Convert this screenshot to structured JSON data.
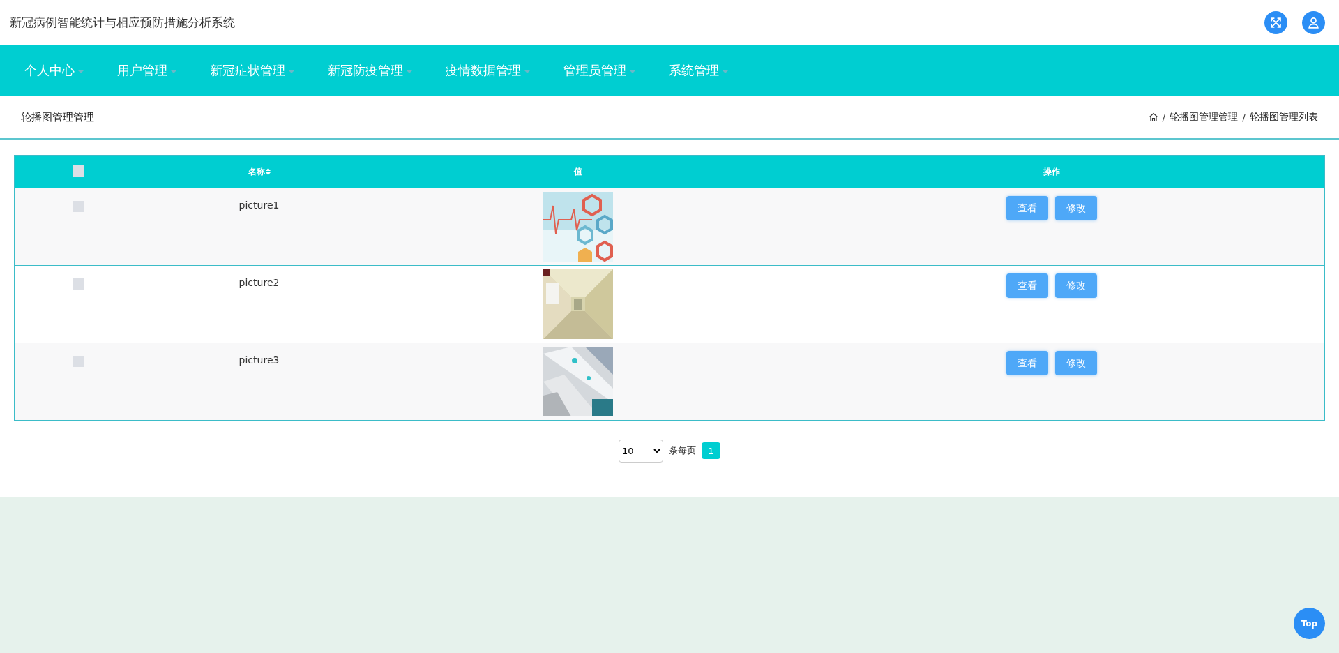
{
  "header": {
    "title": "新冠病例智能统计与相应预防措施分析系统"
  },
  "nav": {
    "items": [
      {
        "label": "个人中心"
      },
      {
        "label": "用户管理"
      },
      {
        "label": "新冠症状管理"
      },
      {
        "label": "新冠防疫管理"
      },
      {
        "label": "疫情数据管理"
      },
      {
        "label": "管理员管理"
      },
      {
        "label": "系统管理"
      }
    ]
  },
  "page_header": {
    "title": "轮播图管理管理",
    "breadcrumb": [
      {
        "separator": "/",
        "label": "轮播图管理管理"
      },
      {
        "separator": "/",
        "label": "轮播图管理列表"
      }
    ]
  },
  "table": {
    "select_all_checked": false,
    "columns": [
      "名称",
      "值",
      "操作"
    ],
    "rows": [
      {
        "checked": false,
        "name": "picture1",
        "value": {
          "kind": "picture"
        },
        "actions": [
          "查看",
          "修改"
        ]
      },
      {
        "checked": false,
        "name": "picture2",
        "value": {
          "kind": "picture"
        },
        "actions": [
          "查看",
          "修改"
        ]
      },
      {
        "checked": false,
        "name": "picture3",
        "value": {
          "kind": "picture"
        },
        "actions": [
          "查看",
          "修改"
        ]
      }
    ]
  },
  "pagination": {
    "page_size": "10",
    "page_size_label": "条每页",
    "pages": [
      {
        "label": "1",
        "selected": true
      }
    ]
  },
  "back_to_top": "Top"
}
